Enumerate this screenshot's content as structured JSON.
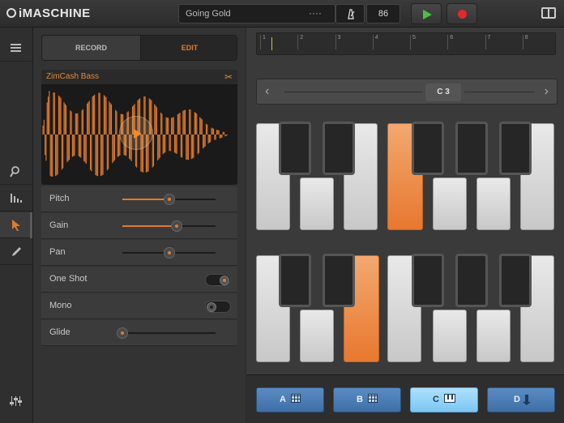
{
  "app": {
    "logo": "iMASCHINE"
  },
  "transport": {
    "song_name": "Going Gold",
    "more": "····",
    "tempo": "86"
  },
  "sampler": {
    "tabs": {
      "record": "RECORD",
      "edit": "EDIT"
    },
    "sample_name": "ZimCash Bass",
    "params": [
      {
        "label": "Pitch",
        "value": 0.5
      },
      {
        "label": "Gain",
        "value": 0.58
      },
      {
        "label": "Pan",
        "value": 0.5
      },
      {
        "label": "One Shot",
        "toggle": true
      },
      {
        "label": "Mono",
        "toggle": false
      },
      {
        "label": "Glide",
        "value": 0.0
      }
    ]
  },
  "timeline": {
    "bars": [
      "1",
      "2",
      "3",
      "4",
      "5",
      "6",
      "7",
      "8"
    ],
    "playhead_position": 1.3
  },
  "keyboard": {
    "octave_label": "C 3"
  },
  "banks": [
    {
      "label": "A",
      "icon": "grid-icon"
    },
    {
      "label": "B",
      "icon": "grid-icon"
    },
    {
      "label": "C",
      "icon": "piano-icon",
      "selected": true
    },
    {
      "label": "D",
      "icon": "download-icon"
    }
  ],
  "colors": {
    "accent": "#e07b2b",
    "play": "#4cc23e",
    "record": "#e2292b",
    "bank": "#4a7db4",
    "bank_selected": "#8fd0f7"
  }
}
